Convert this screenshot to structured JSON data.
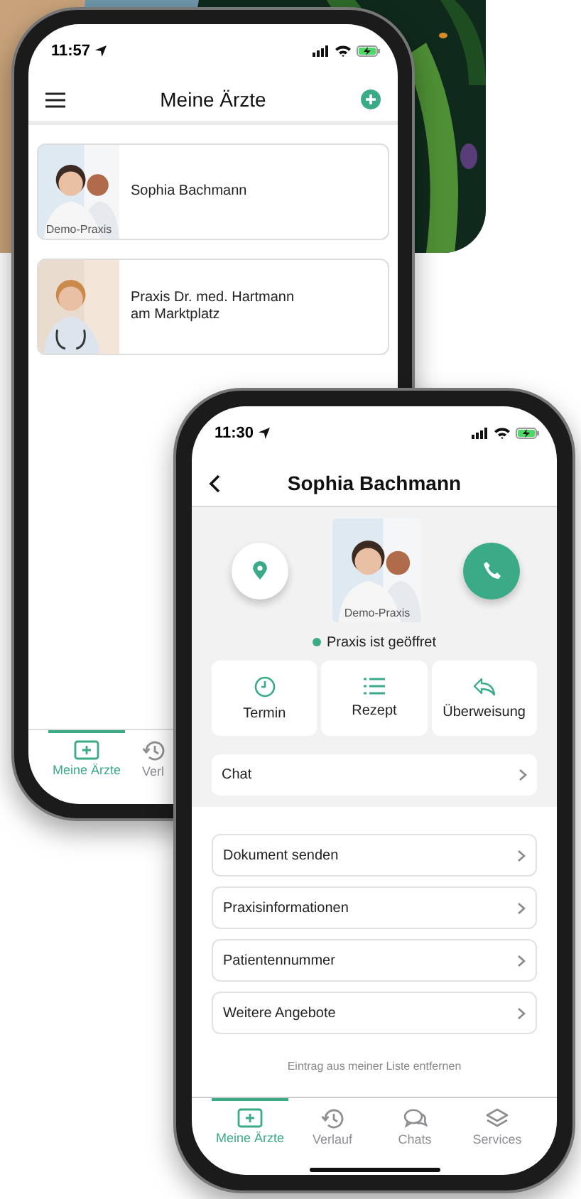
{
  "list_phone": {
    "time": "11:57",
    "title": "Meine Ärzte",
    "doctors": [
      {
        "name": "Sophia Bachmann",
        "caption": "Demo-Praxis"
      },
      {
        "name": "Praxis Dr. med. Hartmann\nam Marktplatz"
      }
    ],
    "tabs": [
      {
        "label": "Meine Ärzte",
        "selected": true
      },
      {
        "label": "Verl",
        "selected": false
      }
    ]
  },
  "detail_phone": {
    "time": "11:30",
    "title": "Sophia Bachmann",
    "caption": "Demo-Praxis",
    "status": {
      "text": "Praxis ist geöffret",
      "open": true
    },
    "actions": [
      "Termin",
      "Rezept",
      "Überweisung"
    ],
    "chat": "Chat",
    "menu": [
      "Dokument senden",
      "Praxisinformationen",
      "Patientennummer",
      "Weitere Angebote"
    ],
    "remove_link": "Eintrag aus meiner Liste entfernen",
    "tabs": [
      {
        "label": "Meine Ärzte",
        "selected": true
      },
      {
        "label": "Verlauf",
        "selected": false
      },
      {
        "label": "Chats",
        "selected": false
      },
      {
        "label": "Services",
        "selected": false
      }
    ]
  }
}
